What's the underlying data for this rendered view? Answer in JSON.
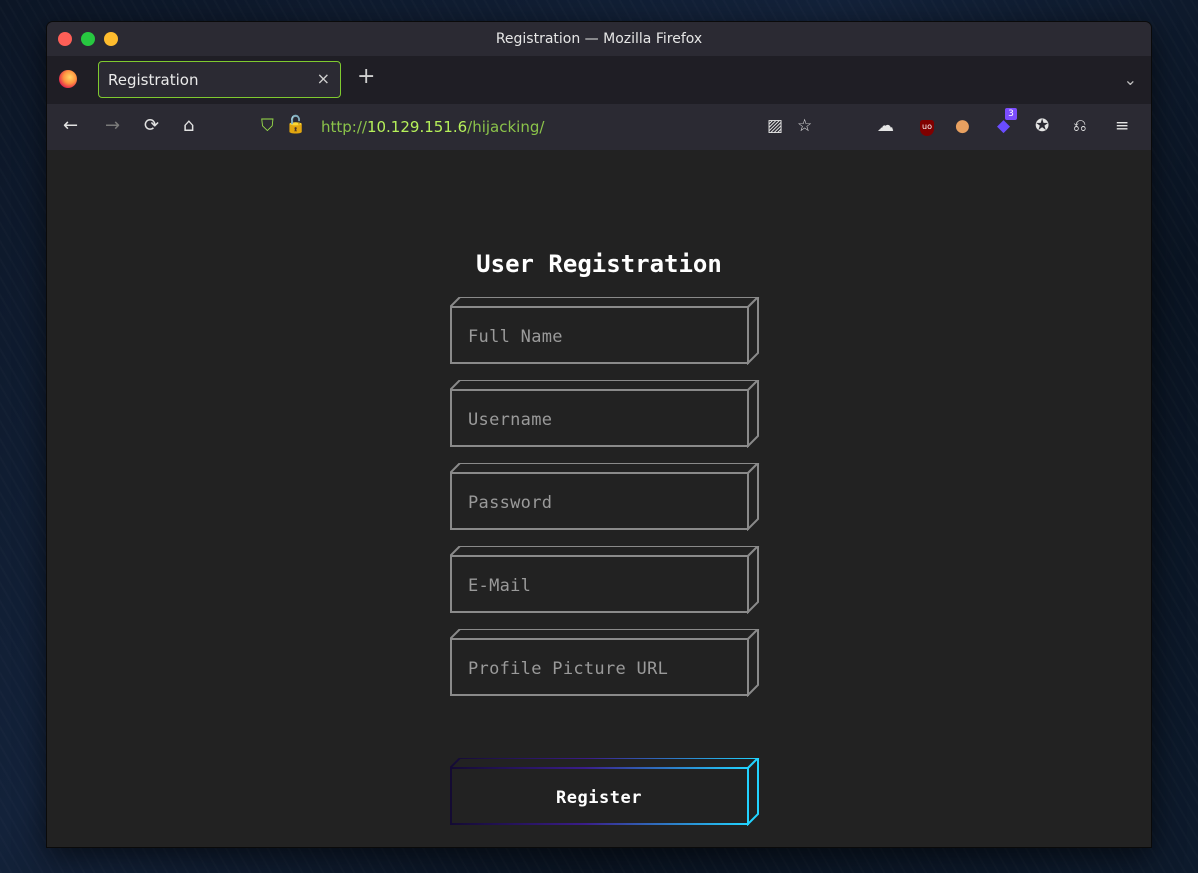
{
  "window": {
    "title": "Registration — Mozilla Firefox"
  },
  "tabs": [
    {
      "label": "Registration",
      "close": "×"
    }
  ],
  "tabbar": {
    "new_tab": "+",
    "list_all": "⌄"
  },
  "nav": {
    "back": "←",
    "forward": "→",
    "reload": "⟳",
    "home": "⌂",
    "url": {
      "scheme": "http://",
      "host": "10.129.151.6",
      "path": "/hijacking/"
    }
  },
  "toolbar": {
    "extension_badge": "3"
  },
  "form": {
    "title": "User Registration",
    "fields": [
      {
        "placeholder": "Full Name"
      },
      {
        "placeholder": "Username"
      },
      {
        "placeholder": "Password"
      },
      {
        "placeholder": "E-Mail"
      },
      {
        "placeholder": "Profile Picture URL"
      }
    ],
    "submit": "Register"
  },
  "colors": {
    "page_bg": "#222222",
    "field_border": "#8a8a8a",
    "button_gradient_start": "#1a0f3a",
    "button_gradient_end": "#22d3ff",
    "tab_accent": "#7fca2f",
    "url_host": "#b6f15a"
  }
}
